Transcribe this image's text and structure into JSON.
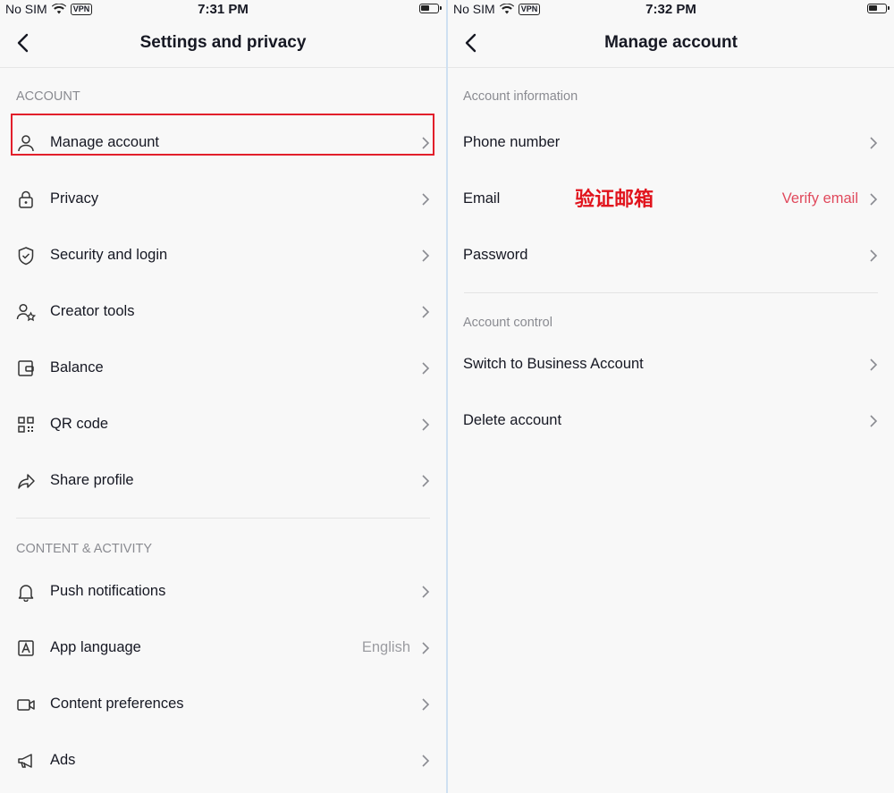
{
  "left": {
    "status": {
      "carrier": "No SIM",
      "vpn": "VPN",
      "time": "7:31 PM"
    },
    "title": "Settings and privacy",
    "sections": [
      {
        "label": "ACCOUNT",
        "items": [
          {
            "label": "Manage account",
            "icon": "person-icon"
          },
          {
            "label": "Privacy",
            "icon": "lock-icon"
          },
          {
            "label": "Security and login",
            "icon": "shield-icon"
          },
          {
            "label": "Creator tools",
            "icon": "creator-star-icon"
          },
          {
            "label": "Balance",
            "icon": "wallet-icon"
          },
          {
            "label": "QR code",
            "icon": "qr-code-icon"
          },
          {
            "label": "Share profile",
            "icon": "share-arrow-icon"
          }
        ]
      },
      {
        "label": "CONTENT & ACTIVITY",
        "items": [
          {
            "label": "Push notifications",
            "icon": "bell-icon"
          },
          {
            "label": "App language",
            "icon": "language-icon",
            "value": "English"
          },
          {
            "label": "Content preferences",
            "icon": "video-camera-icon"
          },
          {
            "label": "Ads",
            "icon": "megaphone-icon"
          }
        ]
      }
    ]
  },
  "right": {
    "status": {
      "carrier": "No SIM",
      "vpn": "VPN",
      "time": "7:32 PM"
    },
    "title": "Manage account",
    "sections": [
      {
        "label": "Account information",
        "items": [
          {
            "label": "Phone number"
          },
          {
            "label": "Email",
            "value": "Verify email"
          },
          {
            "label": "Password"
          }
        ]
      },
      {
        "label": "Account control",
        "items": [
          {
            "label": "Switch to Business Account"
          },
          {
            "label": "Delete account"
          }
        ]
      }
    ],
    "annotation": "验证邮箱"
  },
  "colors": {
    "highlight": "#e21f2b",
    "verify": "#e0495c",
    "annotation": "#e1141d"
  }
}
